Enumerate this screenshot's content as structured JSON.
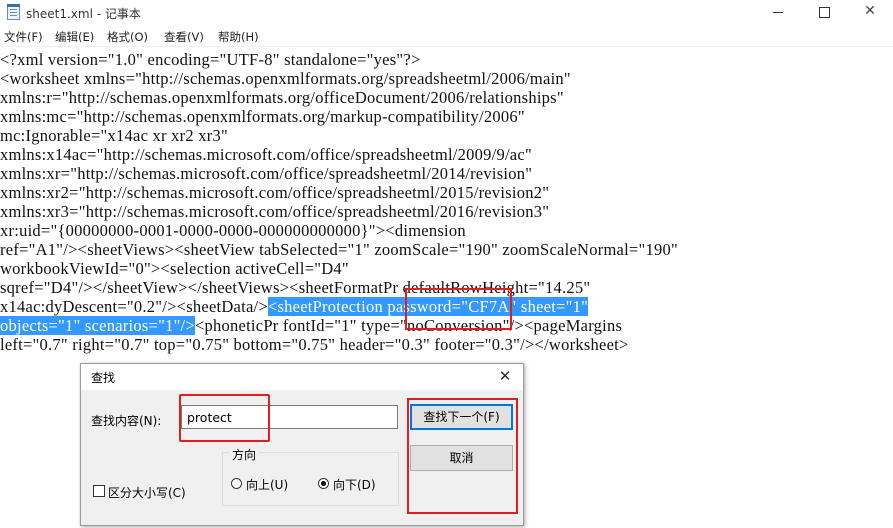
{
  "window": {
    "title": "sheet1.xml - 记事本",
    "minimize": "—",
    "maximize": "",
    "close": "✕"
  },
  "menu": [
    "文件(F)",
    "编辑(E)",
    "格式(O)",
    "查看(V)",
    "帮助(H)"
  ],
  "editor": {
    "lines": [
      "<?xml version=\"1.0\" encoding=\"UTF-8\" standalone=\"yes\"?>",
      "<worksheet xmlns=\"http://schemas.openxmlformats.org/spreadsheetml/2006/main\"",
      "xmlns:r=\"http://schemas.openxmlformats.org/officeDocument/2006/relationships\"",
      "xmlns:mc=\"http://schemas.openxmlformats.org/markup-compatibility/2006\"",
      "mc:Ignorable=\"x14ac xr xr2 xr3\"",
      "xmlns:x14ac=\"http://schemas.microsoft.com/office/spreadsheetml/2009/9/ac\"",
      "xmlns:xr=\"http://schemas.microsoft.com/office/spreadsheetml/2014/revision\"",
      "xmlns:xr2=\"http://schemas.microsoft.com/office/spreadsheetml/2015/revision2\"",
      "xmlns:xr3=\"http://schemas.microsoft.com/office/spreadsheetml/2016/revision3\"",
      "xr:uid=\"{00000000-0001-0000-0000-000000000000}\"><dimension",
      "ref=\"A1\"/><sheetViews><sheetView tabSelected=\"1\" zoomScale=\"190\" zoomScaleNormal=\"190\"",
      "workbookViewId=\"0\"><selection activeCell=\"D4\"",
      "sqref=\"D4\"/></sheetView></sheetViews><sheetFormatPr defaultRowHeight=\"14.25\""
    ],
    "line13_prefix": "x14ac:dyDescent=\"0.2\"/><sheetData/>",
    "line13_selected": "<sheetProtection password=\"CF7A\" sheet=\"1\"",
    "line14_selected": "objects=\"1\" scenarios=\"1\"/>",
    "line14_suffix": "<phoneticPr fontId=\"1\" type=\"noConversion\"/><pageMargins",
    "line15": "left=\"0.7\" right=\"0.7\" top=\"0.75\" bottom=\"0.75\" header=\"0.3\" footer=\"0.3\"/></worksheet>"
  },
  "find_dialog": {
    "title": "查找",
    "close": "✕",
    "find_label": "查找内容(N):",
    "find_value": "protect",
    "find_next_button": "查找下一个(F)",
    "cancel_button": "取消",
    "direction_legend": "方向",
    "direction_up": "向上(U)",
    "direction_down": "向下(D)",
    "direction_selected": "down",
    "match_case_label": "区分大小写(C)",
    "match_case_checked": false
  },
  "highlight_colors": {
    "selection": "#3399ff",
    "annotation_box": "#e02020"
  }
}
